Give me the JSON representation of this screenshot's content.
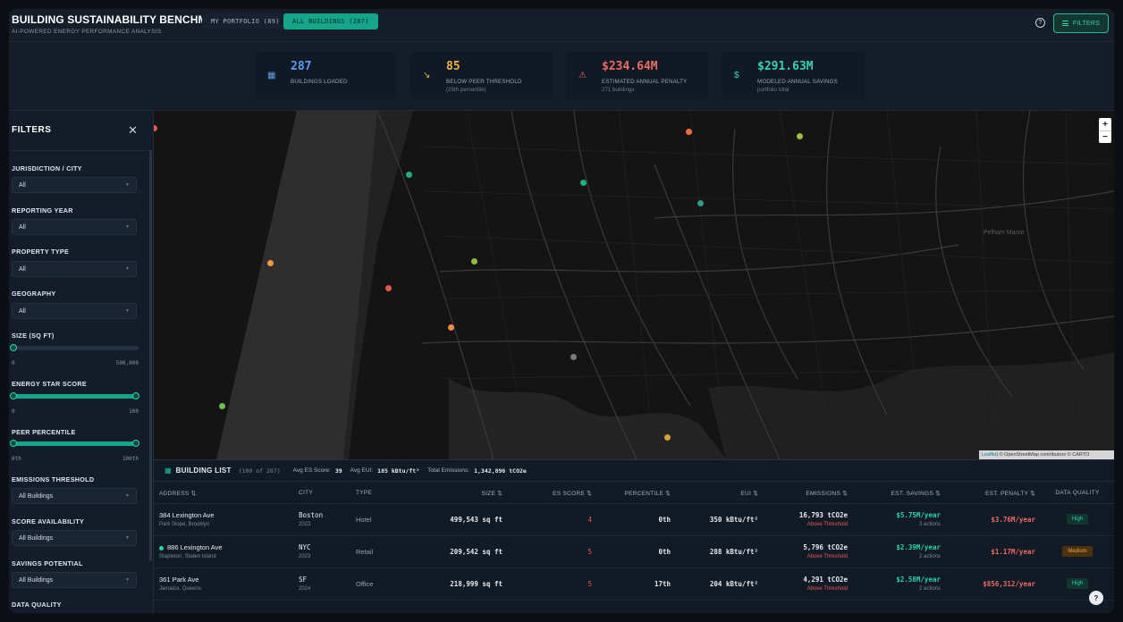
{
  "header": {
    "title": "BUILDING SUSTAINABILITY BENCHMARK",
    "subtitle": "AI-POWERED ENERGY PERFORMANCE ANALYSIS",
    "tab_portfolio": "MY PORTFOLIO (89)",
    "tab_all": "ALL BUILDINGS (287)",
    "filters_label": "FILTERS",
    "help_glyph": "?"
  },
  "stats": [
    {
      "icon": "building-icon",
      "glyph": "▦",
      "value": "287",
      "label": "BUILDINGS LOADED",
      "sub": "",
      "color": "#5b9df0"
    },
    {
      "icon": "trend-down-icon",
      "glyph": "↘",
      "value": "85",
      "label": "BELOW PEER THRESHOLD",
      "sub": "(25th percentile)",
      "color": "#f4b23f"
    },
    {
      "icon": "warning-icon",
      "glyph": "⚠",
      "value": "$234.64M",
      "label": "ESTIMATED ANNUAL PENALTY",
      "sub": "271 buildings",
      "color": "#ee6b62"
    },
    {
      "icon": "dollar-icon",
      "glyph": "$",
      "value": "$291.63M",
      "label": "MODELED ANNUAL SAVINGS",
      "sub": "portfolio total",
      "color": "#35d6ad"
    }
  ],
  "sidebar": {
    "title": "FILTERS",
    "close_glyph": "✕",
    "filters": [
      {
        "label": "JURISDICTION / CITY",
        "value": "All"
      },
      {
        "label": "REPORTING YEAR",
        "value": "All"
      },
      {
        "label": "PROPERTY TYPE",
        "value": "All"
      },
      {
        "label": "GEOGRAPHY",
        "value": "All"
      }
    ],
    "size": {
      "label": "SIZE (SQ FT)",
      "min": "0",
      "max": "500,000",
      "lo": 0,
      "hi": 0
    },
    "energy_star": {
      "label": "ENERGY STAR SCORE",
      "min": "0",
      "max": "100",
      "lo": 0,
      "hi": 1
    },
    "peer": {
      "label": "PEER PERCENTILE",
      "min": "0th",
      "max": "100th",
      "lo": 0,
      "hi": 1
    },
    "filters2": [
      {
        "label": "EMISSIONS THRESHOLD",
        "value": "All Buildings"
      },
      {
        "label": "SCORE AVAILABILITY",
        "value": "All Buildings"
      },
      {
        "label": "SAVINGS POTENTIAL",
        "value": "All Buildings"
      }
    ],
    "last_label": "DATA QUALITY"
  },
  "map": {
    "place_label": "Pelham Manor",
    "zoom_in": "+",
    "zoom_out": "−",
    "attribution_leaflet": "Leaflet",
    "attribution_rest": " | © OpenStreetMap contributors © CARTO"
  },
  "list": {
    "title": "BUILDING LIST",
    "count": "(100 of 287)",
    "avg_es_label": "Avg ES Score:",
    "avg_es_value": "39",
    "avg_eui_label": "Avg EUI:",
    "avg_eui_value": "185 kBtu/ft²",
    "total_em_label": "Total Emissions:",
    "total_em_value": "1,342,896 tCO2e",
    "columns": [
      "ADDRESS ⇅",
      "CITY",
      "TYPE",
      "SIZE ⇅",
      "ES SCORE ⇅",
      "PERCENTILE ⇅",
      "EUI ⇅",
      "EMISSIONS ⇅",
      "EST. SAVINGS ⇅",
      "EST. PENALTY ⇅",
      "DATA QUALITY"
    ],
    "rows": [
      {
        "address": "384 Lexington Ave",
        "area": "Park Slope, Brooklyn",
        "city": "Boston",
        "year": "2023",
        "type": "Hotel",
        "size": "499,543 sq ft",
        "es": "4",
        "pct": "0th",
        "eui": "350 kBtu/ft²",
        "em": "16,793 tCO2e",
        "em_flag": "Above Threshold",
        "sav": "$5.75M/year",
        "actions": "3 actions",
        "pen": "$3.76M/year",
        "quality": "High"
      },
      {
        "address": "886 Lexington Ave",
        "area": "Stapleton, Staten Island",
        "city": "NYC",
        "year": "2023",
        "type": "Retail",
        "size": "209,542 sq ft",
        "es": "5",
        "pct": "0th",
        "eui": "288 kBtu/ft²",
        "em": "5,796 tCO2e",
        "em_flag": "Above Threshold",
        "sav": "$2.39M/year",
        "actions": "2 actions",
        "pen": "$1.17M/year",
        "quality": "Medium"
      },
      {
        "address": "361 Park Ave",
        "area": "Jamaica, Queens",
        "city": "SF",
        "year": "2024",
        "type": "Office",
        "size": "218,999 sq ft",
        "es": "5",
        "pct": "17th",
        "eui": "204 kBtu/ft²",
        "em": "4,291 tCO2e",
        "em_flag": "Above Threshold",
        "sav": "$2.58M/year",
        "actions": "2 actions",
        "pen": "$856,312/year",
        "quality": "High"
      }
    ]
  },
  "colors": {
    "accent": "#14a58a",
    "danger": "#ee6b62",
    "warning": "#f4b23f",
    "success": "#35d6ad",
    "info": "#5b9df0"
  }
}
